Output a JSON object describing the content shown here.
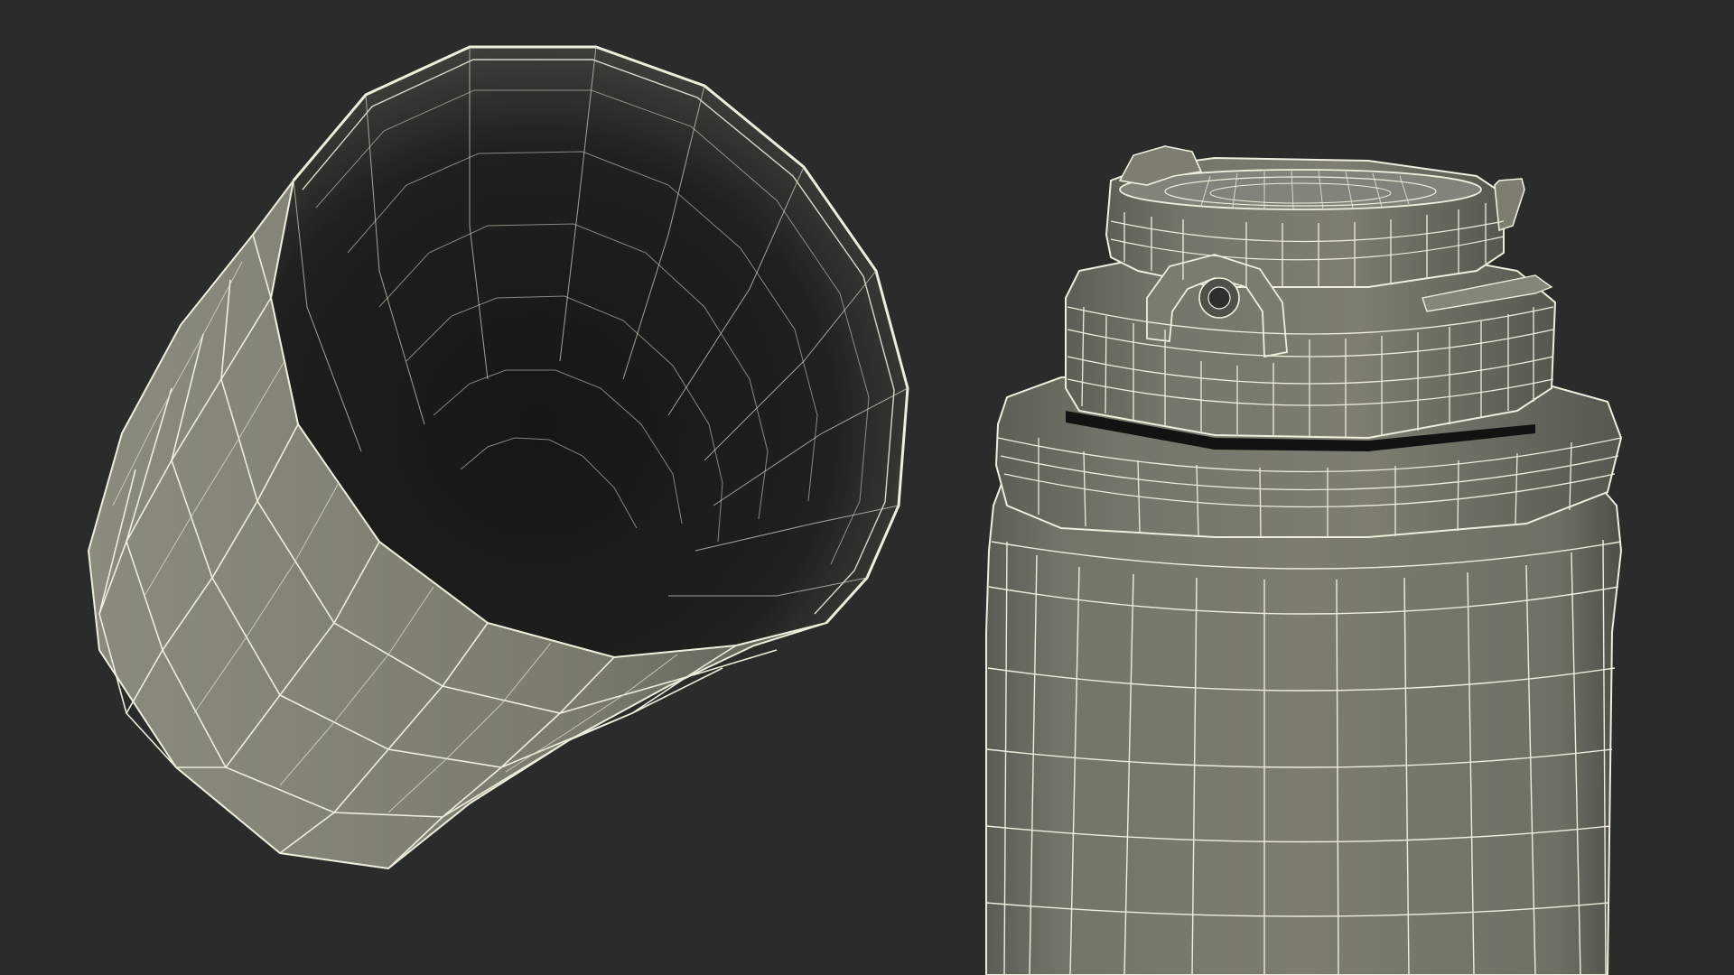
{
  "scene": {
    "background": "#2a2b2b",
    "shell_color": "#7b7c6f",
    "shell_shadow": "#4f5049",
    "interior_dark": "#181918",
    "wire_color": "#eeeedd",
    "objects": [
      {
        "id": "cup",
        "kind": "tumbler-cup-wireframe"
      },
      {
        "id": "bottle",
        "kind": "bottle-with-cap-wireframe"
      }
    ]
  }
}
